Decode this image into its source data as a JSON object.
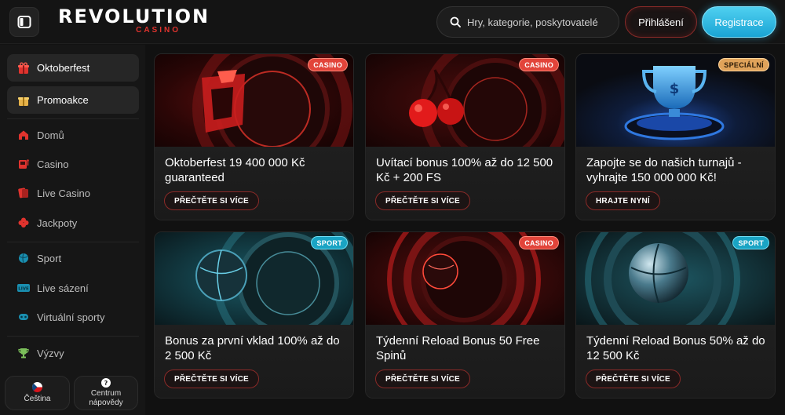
{
  "header": {
    "logo_main": "REVOLUTION",
    "logo_sub": "CASINO",
    "search_placeholder": "Hry, kategorie, poskytovatelé",
    "login_label": "Přihlášení",
    "register_label": "Registrace"
  },
  "sidebar": {
    "featured": [
      {
        "label": "Oktoberfest",
        "icon": "gift-box-red-icon"
      },
      {
        "label": "Promoakce",
        "icon": "gift-icon"
      }
    ],
    "items": [
      {
        "label": "Domů",
        "icon": "home-icon"
      },
      {
        "label": "Casino",
        "icon": "slot-machine-icon"
      },
      {
        "label": "Live Casino",
        "icon": "dealer-icon"
      },
      {
        "label": "Jackpoty",
        "icon": "clover-icon"
      },
      {
        "label": "Sport",
        "icon": "ball-icon"
      },
      {
        "label": "Live sázení",
        "icon": "live-icon"
      },
      {
        "label": "Virtuální sporty",
        "icon": "virtual-sports-icon"
      },
      {
        "label": "Výzvy",
        "icon": "trophy-icon"
      }
    ],
    "language_label": "Čeština",
    "help_label_line1": "Centrum",
    "help_label_line2": "nápovědy"
  },
  "promotions": [
    {
      "title": "Oktoberfest 19 400 000 Kč guaranteed",
      "badge": "CASINO",
      "cta": "PŘEČTĚTE SI VÍCE",
      "art": "red-roulette-letter"
    },
    {
      "title": "Uvítací bonus 100% až do 12 500 Kč + 200 FS",
      "badge": "CASINO",
      "cta": "PŘEČTĚTE SI VÍCE",
      "art": "red-roulette-cherries"
    },
    {
      "title": "Zapojte se do našich turnajů - vyhrajte 150 000 000 Kč!",
      "badge": "SPECIÁLNÍ",
      "cta": "HRAJTE NYNÍ",
      "art": "blue-trophy"
    },
    {
      "title": "Bonus za první vklad 100% až do 2 500 Kč",
      "badge": "SPORT",
      "cta": "PŘEČTĚTE SI VÍCE",
      "art": "teal-roulette-ball"
    },
    {
      "title": "Týdenní Reload Bonus 50 Free Spinů",
      "badge": "CASINO",
      "cta": "PŘEČTĚTE SI VÍCE",
      "art": "red-roulette-ball"
    },
    {
      "title": "Týdenní Reload Bonus 50% až do 12 500 Kč",
      "badge": "SPORT",
      "cta": "PŘEČTĚTE SI VÍCE",
      "art": "teal-sport-ball"
    }
  ],
  "colors": {
    "accent_red": "#e0332e",
    "accent_cyan": "#2bb8e4",
    "background": "#121212"
  }
}
